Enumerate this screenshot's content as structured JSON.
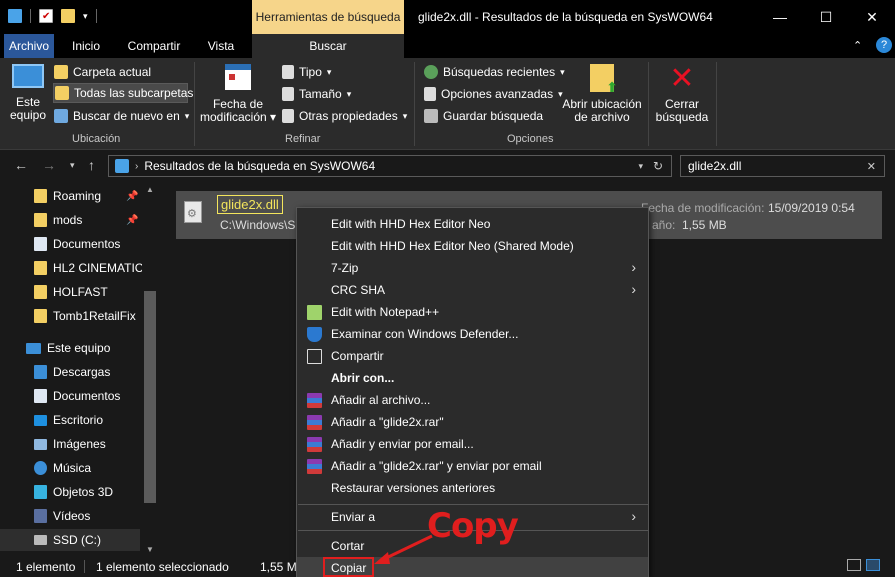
{
  "window": {
    "title": "glide2x.dll - Resultados de la búsqueda en SysWOW64",
    "context_tab": "Herramientas de búsqueda",
    "minimize": "—",
    "maximize": "☐",
    "close": "✕"
  },
  "ribbon_tabs": [
    "Archivo",
    "Inicio",
    "Compartir",
    "Vista",
    "Buscar"
  ],
  "ribbon": {
    "ubicacion": {
      "label": "Ubicación",
      "este_equipo": [
        "Este",
        "equipo"
      ],
      "carpeta_actual": "Carpeta actual",
      "todas_subcarpetas": "Todas las subcarpetas",
      "buscar_de_nuevo": "Buscar de nuevo en"
    },
    "refinar": {
      "label": "Refinar",
      "fecha": [
        "Fecha de",
        "modificación"
      ],
      "tipo": "Tipo",
      "tamano": "Tamaño",
      "otras": "Otras propiedades"
    },
    "opciones": {
      "label": "Opciones",
      "recientes": "Búsquedas recientes",
      "avanzadas": "Opciones avanzadas",
      "guardar": "Guardar búsqueda",
      "abrir_ubicacion": [
        "Abrir ubicación",
        "de archivo"
      ],
      "cerrar": [
        "Cerrar",
        "búsqueda"
      ]
    }
  },
  "address": {
    "path": "Resultados de la búsqueda en SysWOW64",
    "search_value": "glide2x.dll"
  },
  "nav": {
    "quick": [
      {
        "label": "Roaming",
        "pinned": true
      },
      {
        "label": "mods",
        "pinned": true
      },
      {
        "label": "Documentos",
        "pinned": false
      },
      {
        "label": "HL2 CINEMATIC",
        "pinned": false
      },
      {
        "label": "HOLFAST",
        "pinned": false
      },
      {
        "label": "Tomb1RetailFix",
        "pinned": false
      }
    ],
    "pc": "Este equipo",
    "pc_items": [
      "Descargas",
      "Documentos",
      "Escritorio",
      "Imágenes",
      "Música",
      "Objetos 3D",
      "Vídeos",
      "SSD (C:)"
    ]
  },
  "result": {
    "name": "glide2x.dll",
    "path": "C:\\Windows\\S",
    "date_label": "Fecha de modificación:",
    "date": "15/09/2019 0:54",
    "size_label": "año:",
    "size": "1,55 MB"
  },
  "status": {
    "count": "1 elemento",
    "selected": "1 elemento seleccionado",
    "size": "1,55 MB"
  },
  "context_menu": {
    "items": [
      "Edit with HHD Hex Editor Neo",
      "Edit with HHD Hex Editor Neo (Shared Mode)",
      "7-Zip",
      "CRC SHA",
      "Edit with Notepad++",
      "Examinar con Windows Defender...",
      "Compartir",
      "Abrir con...",
      "Añadir al archivo...",
      "Añadir a \"glide2x.rar\"",
      "Añadir y enviar por email...",
      "Añadir a \"glide2x.rar\" y enviar por email",
      "Restaurar versiones anteriores",
      "Enviar a",
      "Cortar",
      "Copiar"
    ]
  },
  "annotation": "Copy",
  "colors": {
    "accent": "#2b579a",
    "context_tab": "#f6d58a",
    "highlight": "#e01e1e",
    "name_outline": "#f3e55c"
  }
}
